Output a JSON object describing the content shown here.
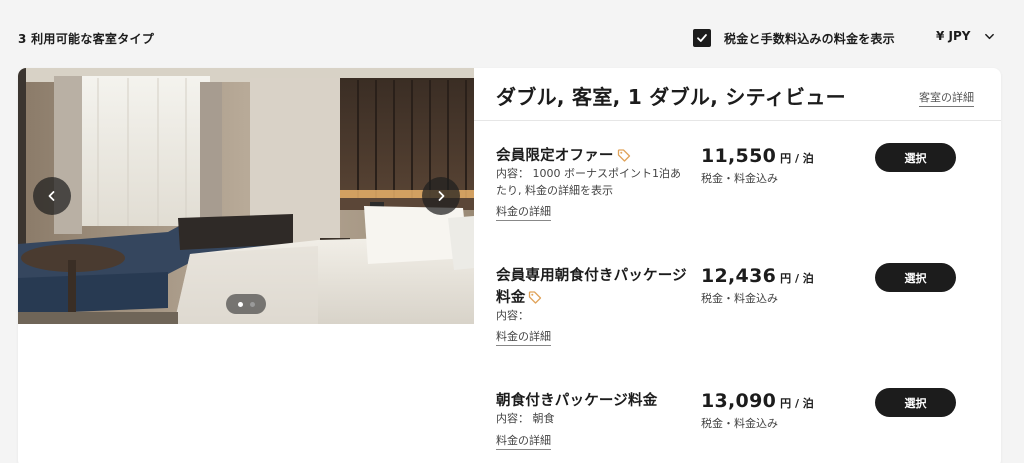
{
  "header": {
    "room_count_label": "3 利用可能な客室タイプ",
    "tax_toggle_label": "税金と手数料込みの料金を表示",
    "tax_toggle_checked": true,
    "currency_label": "¥ JPY"
  },
  "room": {
    "title": "ダブル, 客室, 1 ダブル, シティビュー",
    "details_link": "客室の詳細",
    "photo": {
      "icon_prev": "chevron-left-icon",
      "icon_next": "chevron-right-icon",
      "slide_count": 2,
      "current_slide": 1
    }
  },
  "rates": [
    {
      "name": "会員限定オファー",
      "has_tag": true,
      "content": "内容： 1000 ボーナスポイント1泊あたり, 料金の詳細を表示",
      "link": "料金の詳細",
      "price": "11,550",
      "unit": "円 / 泊",
      "tax_note": "税金・料金込み",
      "button": "選択"
    },
    {
      "name": "会員専用朝食付きパッケージ料金",
      "has_tag": true,
      "content": "内容：",
      "link": "料金の詳細",
      "price": "12,436",
      "unit": "円 / 泊",
      "tax_note": "税金・料金込み",
      "button": "選択"
    },
    {
      "name": "朝食付きパッケージ料金",
      "has_tag": false,
      "content": "内容： 朝食",
      "link": "料金の詳細",
      "price": "13,090",
      "unit": "円 / 泊",
      "tax_note": "税金・料金込み",
      "button": "選択"
    }
  ],
  "colors": {
    "page_bg": "#f4f4f4",
    "card_bg": "#ffffff",
    "button_bg": "#1c1c1c",
    "tag_accent": "#e0a35a"
  }
}
